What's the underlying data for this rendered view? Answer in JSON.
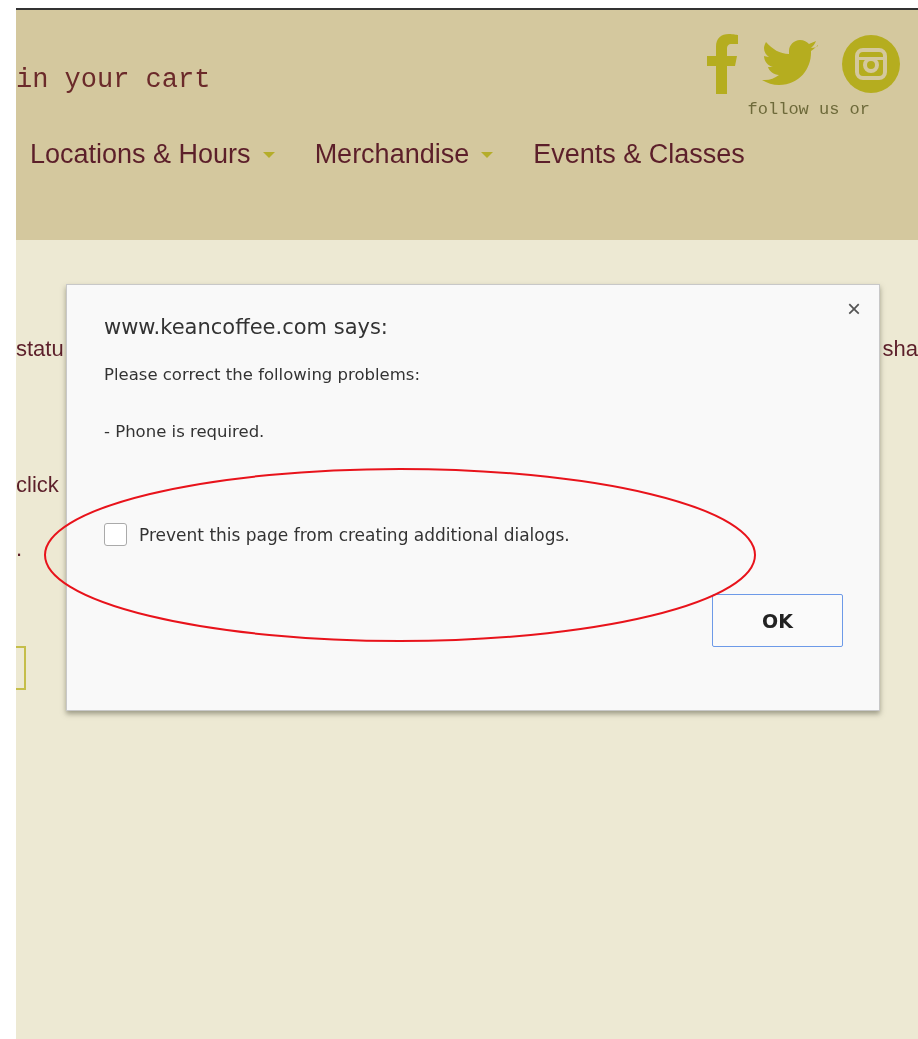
{
  "header": {
    "cart_text": "in your cart",
    "social_caption": "follow us or",
    "nav": [
      {
        "label": "Locations & Hours",
        "has_menu": true
      },
      {
        "label": "Merchandise",
        "has_menu": true
      },
      {
        "label": "Events & Classes",
        "has_menu": false
      }
    ]
  },
  "content": {
    "row_1_left": "statu",
    "row_1_right": "sha",
    "row_2": "click",
    "row_3": "."
  },
  "dialog": {
    "title": "www.keancoffee.com says:",
    "close": "×",
    "lines": [
      "Please correct the following problems:",
      "- Phone is required."
    ],
    "checkbox": {
      "label": "Prevent this page from creating additional dialogs.",
      "checked": false
    },
    "buttons": [
      "OK"
    ]
  }
}
